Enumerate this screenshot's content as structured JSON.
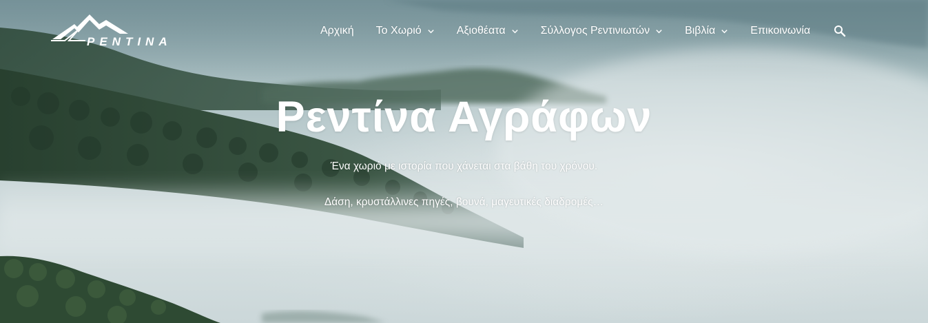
{
  "site": {
    "logo_text": "PENTINA",
    "logo_icon": "mountain-logo-icon"
  },
  "nav": {
    "items": [
      {
        "label": "Αρχική",
        "has_dropdown": false
      },
      {
        "label": "Το Χωριό",
        "has_dropdown": true
      },
      {
        "label": "Αξιοθέατα",
        "has_dropdown": true
      },
      {
        "label": "Σύλλογος Ρεντινιωτών",
        "has_dropdown": true
      },
      {
        "label": "Βιβλία",
        "has_dropdown": true
      },
      {
        "label": "Επικοινωνία",
        "has_dropdown": false
      }
    ],
    "search_icon": "search-icon"
  },
  "hero": {
    "title": "Ρεντίνα Αγράφων",
    "subtitle_1": "Ένα χωριό με ιστορία που χάνεται στα βάθη του χρόνου.",
    "subtitle_2": "Δάση, κρυστάλλινες πηγές, βουνά, μαγευτικές διαδρομές…"
  },
  "colors": {
    "text": "#ffffff",
    "forest_dark": "#2c4536",
    "mist": "#d6e0e1"
  }
}
